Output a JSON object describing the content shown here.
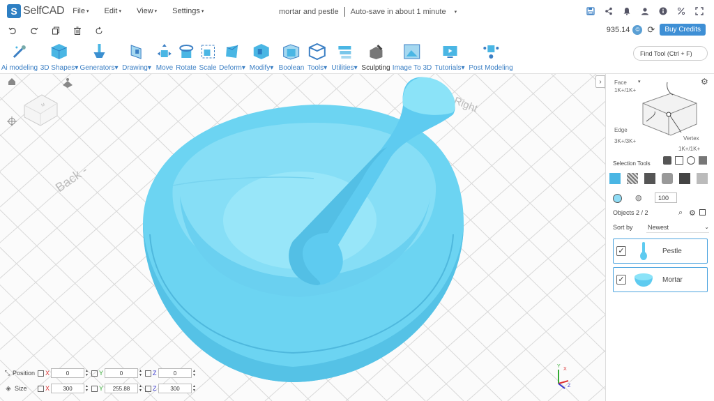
{
  "app": {
    "name": "SelfCAD",
    "logo_letter": "S"
  },
  "menu": [
    {
      "label": "File"
    },
    {
      "label": "Edit"
    },
    {
      "label": "View"
    },
    {
      "label": "Settings"
    }
  ],
  "document": {
    "title": "mortar and pestle",
    "autosave": "Auto-save in about 1 minute"
  },
  "top_icons": [
    "save-icon",
    "share-icon",
    "bell-icon",
    "user-icon",
    "info-icon",
    "percent-icon",
    "fullscreen-icon"
  ],
  "quick_actions": [
    "undo-icon",
    "redo-icon",
    "copy-icon",
    "delete-icon",
    "reset-icon"
  ],
  "credits": {
    "amount": "935.14",
    "buy_label": "Buy Credits"
  },
  "toolbar": [
    {
      "label": "Ai modeling",
      "caret": false,
      "icon": "ai-modeling-icon"
    },
    {
      "label": "3D Shapes",
      "caret": true,
      "icon": "cube-icon"
    },
    {
      "label": "Generators",
      "caret": true,
      "icon": "generator-icon"
    },
    {
      "label": "Drawing",
      "caret": true,
      "icon": "drawing-icon"
    },
    {
      "label": "Move",
      "caret": false,
      "icon": "move-icon"
    },
    {
      "label": "Rotate",
      "caret": false,
      "icon": "rotate-icon"
    },
    {
      "label": "Scale",
      "caret": false,
      "icon": "scale-icon"
    },
    {
      "label": "Deform",
      "caret": true,
      "icon": "deform-icon"
    },
    {
      "label": "Modify",
      "caret": true,
      "icon": "modify-icon"
    },
    {
      "label": "Boolean",
      "caret": false,
      "icon": "boolean-icon"
    },
    {
      "label": "Tools",
      "caret": true,
      "icon": "tools-icon"
    },
    {
      "label": "Utilities",
      "caret": true,
      "icon": "utilities-icon"
    },
    {
      "label": "Sculpting",
      "caret": false,
      "icon": "sculpting-icon"
    },
    {
      "label": "Image To 3D",
      "caret": false,
      "icon": "image-to-3d-icon"
    },
    {
      "label": "Tutorials",
      "caret": true,
      "icon": "tutorials-icon"
    },
    {
      "label": "Post Modeling",
      "caret": false,
      "icon": "post-modeling-icon"
    }
  ],
  "find_tool": {
    "placeholder": "Find Tool (Ctrl + F)"
  },
  "viewport": {
    "label_back": "Back -",
    "label_right": "Right"
  },
  "selection": {
    "face_label": "Face",
    "face_count": "1K+/1K+",
    "edge_label": "Edge",
    "edge_count": "3K+/3K+",
    "vertex_label": "Vertex",
    "vertex_count": "1K+/1K+",
    "tools_title": "Selection Tools",
    "brush_size": "100"
  },
  "objects": {
    "label": "Objects 2 / 2",
    "sort_label": "Sort by",
    "sort_value": "Newest",
    "items": [
      {
        "name": "Pestle",
        "checked": true
      },
      {
        "name": "Mortar",
        "checked": true
      }
    ]
  },
  "transform": {
    "position_label": "Position",
    "size_label": "Size",
    "position": {
      "x": "0",
      "y": "0",
      "z": "0"
    },
    "size": {
      "x": "300",
      "y": "255.88",
      "z": "300"
    }
  },
  "colors": {
    "accent": "#3b7fc4",
    "model": "#6cd4f2",
    "grid": "#d8d8d8",
    "buy_button": "#3e8fd5"
  }
}
